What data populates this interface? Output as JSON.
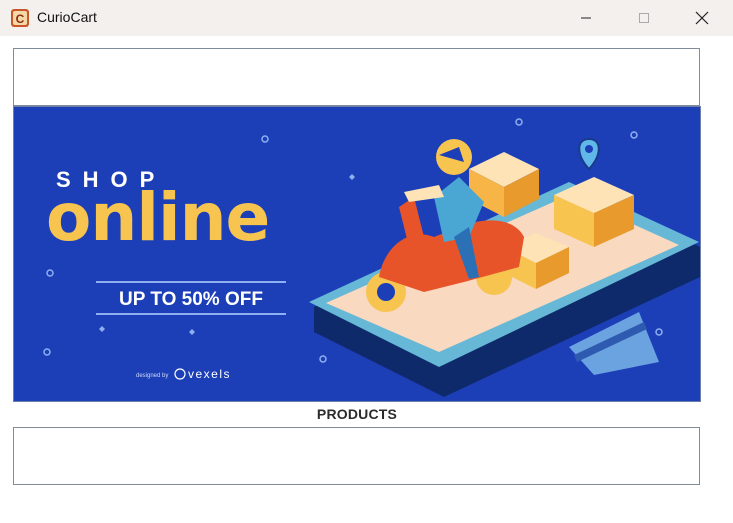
{
  "window": {
    "title": "CurioCart",
    "app_icon": "curiocart-logo-icon",
    "controls": {
      "minimize_icon": "minimize-icon",
      "maximize_icon": "maximize-icon",
      "close_icon": "close-icon"
    }
  },
  "banner": {
    "shop": "SHOP",
    "online": "online",
    "offer": "UP TO 50% OFF",
    "credit_prefix": "designed by",
    "credit_brand": "vexels",
    "colors": {
      "background": "#1c3fb8",
      "accent_yellow": "#f7c450",
      "scooter_orange": "#e8542a",
      "phone_teal": "#67b8d6"
    }
  },
  "products_label": "PRODUCTS"
}
